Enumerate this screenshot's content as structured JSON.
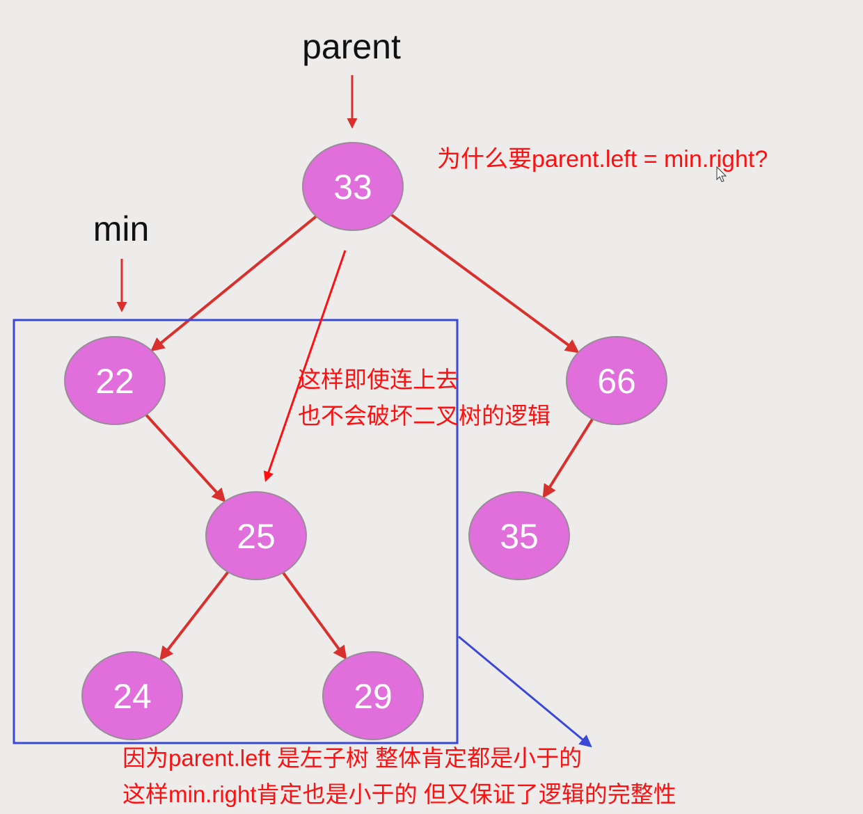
{
  "labels": {
    "parent": "parent",
    "min": "min"
  },
  "nodes": [
    {
      "id": "n33",
      "value": "33"
    },
    {
      "id": "n22",
      "value": "22"
    },
    {
      "id": "n66",
      "value": "66"
    },
    {
      "id": "n25",
      "value": "25"
    },
    {
      "id": "n35",
      "value": "35"
    },
    {
      "id": "n24",
      "value": "24"
    },
    {
      "id": "n29",
      "value": "29"
    }
  ],
  "edges": [
    [
      "n33",
      "n22"
    ],
    [
      "n33",
      "n66"
    ],
    [
      "n22",
      "n25"
    ],
    [
      "n66",
      "n35"
    ],
    [
      "n25",
      "n24"
    ],
    [
      "n25",
      "n29"
    ]
  ],
  "annotations": {
    "question": "为什么要parent.left = min.right?",
    "middle_line1": "这样即使连上去",
    "middle_line2": "也不会破坏二叉树的逻辑",
    "bottom_line1": "因为parent.left 是左子树 整体肯定都是小于的",
    "bottom_line2": "这样min.right肯定也是小于的 但又保证了逻辑的完整性"
  },
  "colors": {
    "node_fill": "#e06fdc",
    "edge": "#d8302c",
    "annotation": "#ff1010",
    "box": "#3a48d8"
  }
}
